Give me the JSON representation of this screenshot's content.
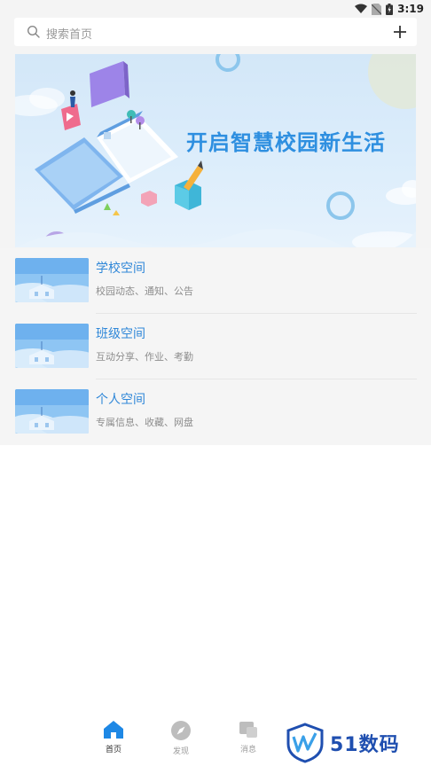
{
  "status_bar": {
    "time": "3:19"
  },
  "search": {
    "placeholder": "搜索首页"
  },
  "banner": {
    "title": "开启智慧校园新生活"
  },
  "spaces": [
    {
      "title": "学校空间",
      "subtitle": "校园动态、通知、公告"
    },
    {
      "title": "班级空间",
      "subtitle": "互动分享、作业、考勤"
    },
    {
      "title": "个人空间",
      "subtitle": "专属信息、收藏、网盘"
    }
  ],
  "bottom_nav": [
    {
      "label": "首页",
      "icon": "home-icon",
      "active": true
    },
    {
      "label": "发现",
      "icon": "compass-icon",
      "active": false
    },
    {
      "label": "消息",
      "icon": "message-icon",
      "active": false
    }
  ],
  "watermark": {
    "text": "51数码"
  },
  "colors": {
    "accent": "#2f87d8",
    "banner_bg": "#d3e7f8",
    "page_bg": "#f4f4f4"
  }
}
